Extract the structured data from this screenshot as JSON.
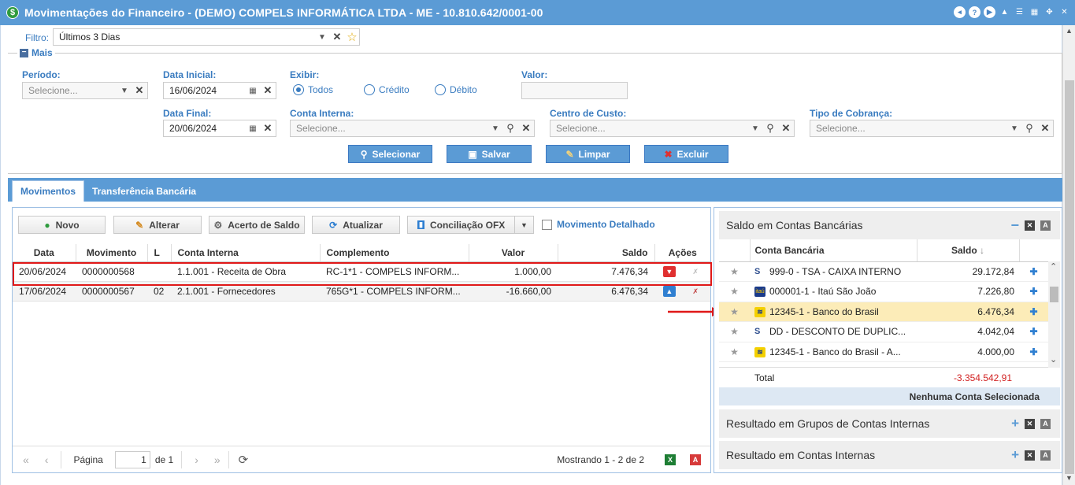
{
  "window": {
    "title": "Movimentações do Financeiro - (DEMO) COMPELS INFORMÁTICA LTDA - ME - 10.810.642/0001-00"
  },
  "filter": {
    "label": "Filtro:",
    "value": "Últimos 3 Dias"
  },
  "mais": {
    "label": "Mais"
  },
  "form": {
    "periodo": {
      "label": "Período:",
      "placeholder": "Selecione..."
    },
    "data_inicial": {
      "label": "Data Inicial:",
      "value": "16/06/2024"
    },
    "data_final": {
      "label": "Data Final:",
      "value": "20/06/2024"
    },
    "exibir": {
      "label": "Exibir:",
      "options": [
        "Todos",
        "Crédito",
        "Débito"
      ],
      "selected": "Todos"
    },
    "valor": {
      "label": "Valor:",
      "value": ""
    },
    "conta_interna": {
      "label": "Conta Interna:",
      "placeholder": "Selecione..."
    },
    "centro_custo": {
      "label": "Centro de Custo:",
      "placeholder": "Selecione..."
    },
    "tipo_cobranca": {
      "label": "Tipo de Cobrança:",
      "placeholder": "Selecione..."
    },
    "buttons": {
      "selecionar": "Selecionar",
      "salvar": "Salvar",
      "limpar": "Limpar",
      "excluir": "Excluir"
    }
  },
  "tabs": [
    {
      "label": "Movimentos",
      "active": true
    },
    {
      "label": "Transferência Bancária",
      "active": false
    }
  ],
  "toolbar": {
    "novo": "Novo",
    "alterar": "Alterar",
    "acerto": "Acerto de Saldo",
    "atualizar": "Atualizar",
    "conciliacao": "Conciliação OFX",
    "detalhado": "Movimento Detalhado"
  },
  "grid": {
    "columns": [
      "Data",
      "Movimento",
      "L",
      "Conta Interna",
      "Complemento",
      "Valor",
      "Saldo",
      "Ações"
    ],
    "rows": [
      {
        "data": "20/06/2024",
        "movimento": "0000000568",
        "l": "",
        "conta": "1.1.001 - Receita de Obra",
        "complemento": "RC-1*1 - COMPELS INFORM...",
        "valor": "1.000,00",
        "saldo": "7.476,34"
      },
      {
        "data": "17/06/2024",
        "movimento": "0000000567",
        "l": "02",
        "conta": "2.1.001 - Fornecedores",
        "complemento": "765G*1 - COMPELS INFORM...",
        "valor": "-16.660,00",
        "saldo": "6.476,34"
      }
    ]
  },
  "pager": {
    "pagina_label": "Página",
    "page": "1",
    "de": "de 1",
    "mostrando": "Mostrando 1 - 2 de 2"
  },
  "saldo": {
    "title": "Saldo em Contas Bancárias",
    "col_conta": "Conta Bancária",
    "col_saldo": "Saldo",
    "rows": [
      {
        "conta": "999-0 - TSA - CAIXA INTERNO",
        "saldo": "29.172,84"
      },
      {
        "conta": "000001-1 - Itaú São João",
        "saldo": "7.226,80"
      },
      {
        "conta": "12345-1 - Banco do Brasil",
        "saldo": "6.476,34"
      },
      {
        "conta": "DD - DESCONTO DE DUPLIC...",
        "saldo": "4.042,04"
      },
      {
        "conta": "12345-1 - Banco do Brasil - A...",
        "saldo": "4.000,00"
      }
    ],
    "total_label": "Total",
    "total_value": "-3.354.542,91",
    "nenhuma": "Nenhuma Conta Selecionada"
  },
  "sections": {
    "grupos": "Resultado em Grupos de Contas Internas",
    "internas": "Resultado em Contas Internas"
  },
  "colors": {
    "accent": "#5b9bd5",
    "label_blue": "#3a7cc0",
    "negative": "#d12020",
    "highlight": "#fcecb8",
    "red_box": "#e01818"
  }
}
